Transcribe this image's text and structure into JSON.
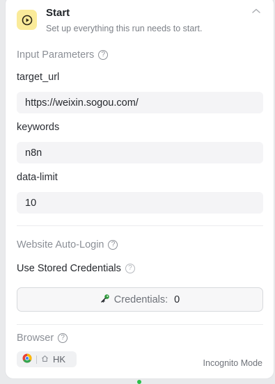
{
  "node": {
    "title": "Start",
    "subtitle": "Set up everything this run needs to start.",
    "icon": "play-circle-icon",
    "accent_color": "#faeb9a"
  },
  "input_parameters": {
    "section_title": "Input Parameters",
    "fields": [
      {
        "label": "target_url",
        "value": "https://weixin.sogou.com/"
      },
      {
        "label": "keywords",
        "value": "n8n"
      },
      {
        "label": "data-limit",
        "value": "10"
      }
    ]
  },
  "auto_login": {
    "section_title": "Website Auto-Login",
    "stored_credentials_label": "Use Stored Credentials",
    "credentials_button_label": "Credentials:",
    "credentials_count": "0"
  },
  "browser": {
    "section_title": "Browser",
    "region": "HK",
    "mode": "Incognito Mode"
  }
}
